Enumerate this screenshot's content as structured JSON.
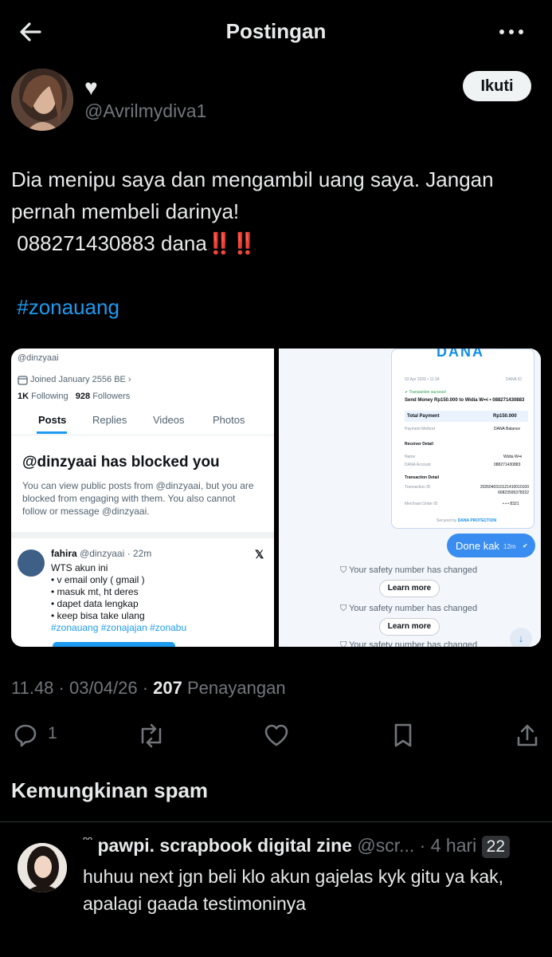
{
  "header": {
    "title": "Postingan"
  },
  "post": {
    "display_name": "♥",
    "handle": "@Avrilmydiva1",
    "follow_label": "Ikuti",
    "text_line1": "Dia menipu saya dan mengambil uang saya. Jangan pernah membeli darinya!",
    "text_line2": "088271430883 dana",
    "bangs": "‼️‼️",
    "hashtag": "#zonauang",
    "timestamp": "11.48 · 03/04/26 · ",
    "views_count": "207",
    "views_label": " Penayangan",
    "reply_count": "1"
  },
  "media_left": {
    "handle": "@dinzyaai",
    "joined": "Joined January 2556 BE",
    "following_count": "1K",
    "following_label": "Following",
    "followers_count": "928",
    "followers_label": "Followers",
    "tabs": [
      "Posts",
      "Replies",
      "Videos",
      "Photos"
    ],
    "blocked_title": "@dinzyaai has blocked you",
    "blocked_line1": "You can view public posts from @dinzyaai, but you are",
    "blocked_line2": "blocked from engaging with them. You also cannot",
    "blocked_line3": "follow or message @dinzyaai.",
    "post_name": "fahira",
    "post_handle": "@dinzyaai · 22m",
    "post_lines": [
      "WTS akun ini",
      "• v email only ( gmail )",
      "• masuk mt, ht deres",
      "• dapet data lengkap",
      "• keep bisa take ulang"
    ],
    "post_tags": "#zonauang #zonajajan #zonabu"
  },
  "media_right": {
    "dana_logo": "DANA",
    "date": "03 Apr 2026 • 11:34",
    "dana_id": "DANA ID",
    "tx_success": "Transaction success!",
    "send_money": "Send Money Rp150.000 to Widia W••i • 088271430883",
    "total_label": "Total Payment",
    "total_value": "Rp150.000",
    "method_label": "Payment Method",
    "method_value": "DANA Balance",
    "receiver_title": "Receiver Detail",
    "name_label": "Name",
    "name_value": "Widia W••i",
    "account_label": "DANA Account",
    "account_value": "088271430883",
    "tx_detail_title": "Transaction Detail",
    "txid_label": "Transaction ID",
    "txid_value1": "2026040310121410010100",
    "txid_value2": "668235953783",
    "txid_value3": "22",
    "merchant_label": "Merchant Order ID",
    "merchant_value": "• • • 8321",
    "secured": "Secured by",
    "protection": "DANA PROTECTION",
    "done_msg": "Done kak",
    "done_time": "12m",
    "safety1": "Your safety number has changed",
    "learn1": "Learn more",
    "safety2": "Your safety number has changed",
    "learn2": "Learn more",
    "safety3": "Your safety number has changed"
  },
  "spam_heading": "Kemungkinan spam",
  "reply": {
    "name": "pawpi. scrapbook digital zine",
    "handle": "@scr...",
    "time": "· 4 hari",
    "badge": "22",
    "text": "huhuu next jgn beli klo akun gajelas kyk gitu ya kak, apalagi gaada testimoninya"
  }
}
